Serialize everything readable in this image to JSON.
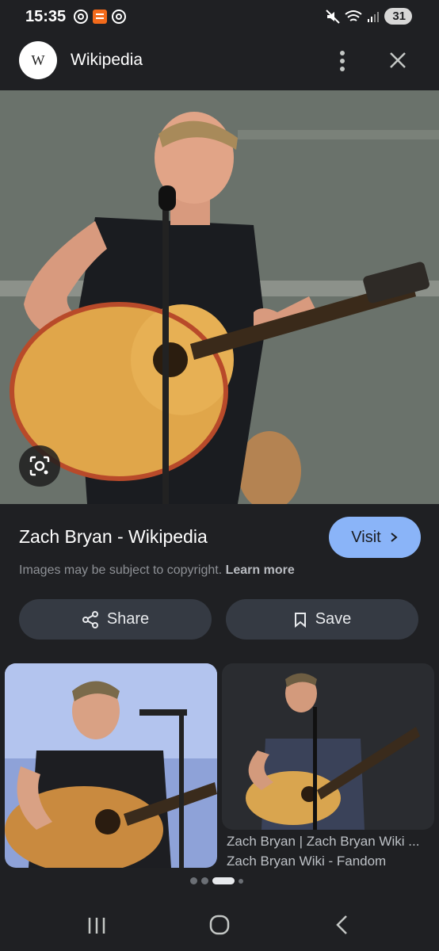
{
  "status_bar": {
    "time": "15:35",
    "battery_level": "31",
    "left_icons": [
      "threads-icon",
      "notification-app-icon",
      "threads-icon"
    ],
    "right_icons": [
      "mute-icon",
      "wifi-icon",
      "signal-icon",
      "battery-icon"
    ]
  },
  "header": {
    "site_logo": "W",
    "site_name": "Wikipedia"
  },
  "result": {
    "title": "Zach Bryan - Wikipedia",
    "visit_label": "Visit",
    "copyright_text": "Images may be subject to copyright.",
    "learn_more_label": "Learn more",
    "share_label": "Share",
    "save_label": "Save"
  },
  "related": [
    {
      "title": "",
      "source": ""
    },
    {
      "title": "Zach Bryan | Zach Bryan Wiki ...",
      "source": "Zach Bryan Wiki - Fandom"
    }
  ],
  "pager": {
    "total": 4,
    "active_index": 2
  },
  "colors": {
    "background": "#1f2023",
    "accent_button": "#8ab4f8",
    "action_button": "#353a43"
  }
}
